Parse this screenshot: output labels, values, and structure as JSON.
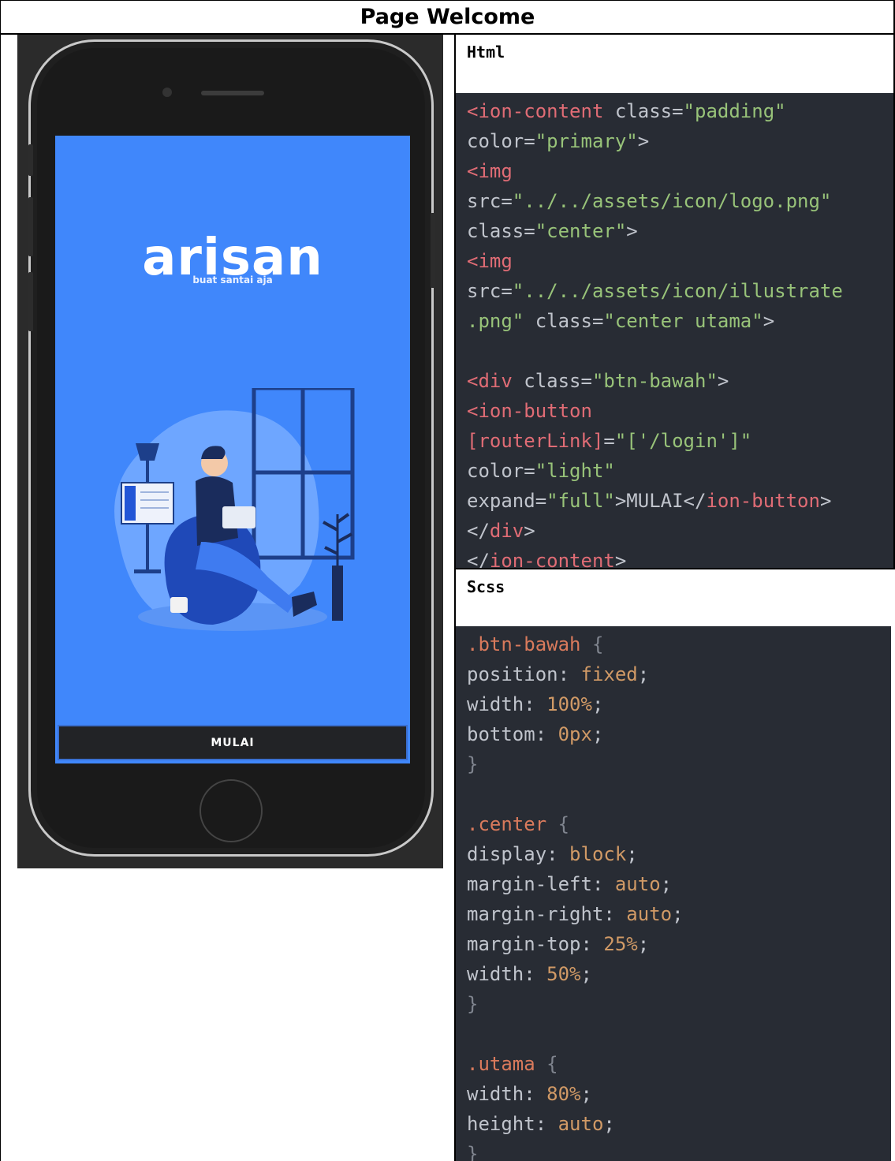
{
  "page_title": "Page Welcome",
  "phone": {
    "app_logo": "arisan",
    "tagline": "buat santai aja",
    "button_label": "MULAI",
    "screen_color": "#4087fb"
  },
  "html_section": {
    "label": "Html",
    "lines": [
      [
        {
          "c": "t",
          "v": "<ion-content "
        },
        {
          "c": "p",
          "v": "class="
        },
        {
          "c": "s",
          "v": "\"padding\""
        }
      ],
      [
        {
          "c": "p",
          "v": "color="
        },
        {
          "c": "s",
          "v": "\"primary\""
        },
        {
          "c": "p",
          "v": ">"
        }
      ],
      [
        {
          "c": "t",
          "v": "<img"
        }
      ],
      [
        {
          "c": "p",
          "v": "src="
        },
        {
          "c": "s",
          "v": "\"../../assets/icon/logo.png\""
        }
      ],
      [
        {
          "c": "p",
          "v": "class="
        },
        {
          "c": "s",
          "v": "\"center\""
        },
        {
          "c": "p",
          "v": ">"
        }
      ],
      [
        {
          "c": "t",
          "v": "<img"
        }
      ],
      [
        {
          "c": "p",
          "v": "src="
        },
        {
          "c": "s",
          "v": "\"../../assets/icon/illustrate"
        }
      ],
      [
        {
          "c": "s",
          "v": ".png\""
        },
        {
          "c": "p",
          "v": " class="
        },
        {
          "c": "s",
          "v": "\"center utama\""
        },
        {
          "c": "p",
          "v": ">"
        }
      ],
      [],
      [
        {
          "c": "t",
          "v": "<div "
        },
        {
          "c": "p",
          "v": "class="
        },
        {
          "c": "s",
          "v": "\"btn-bawah\""
        },
        {
          "c": "p",
          "v": ">"
        }
      ],
      [
        {
          "c": "t",
          "v": "<ion-button"
        }
      ],
      [
        {
          "c": "t",
          "v": "[routerLink]"
        },
        {
          "c": "p",
          "v": "="
        },
        {
          "c": "s",
          "v": "\"['/login']\""
        }
      ],
      [
        {
          "c": "p",
          "v": "color="
        },
        {
          "c": "s",
          "v": "\"light\""
        }
      ],
      [
        {
          "c": "p",
          "v": "expand="
        },
        {
          "c": "s",
          "v": "\"full\""
        },
        {
          "c": "p",
          "v": ">MULAI</"
        },
        {
          "c": "t",
          "v": "ion-button"
        },
        {
          "c": "p",
          "v": ">"
        }
      ],
      [
        {
          "c": "p",
          "v": "</"
        },
        {
          "c": "t",
          "v": "div"
        },
        {
          "c": "p",
          "v": ">"
        }
      ],
      [
        {
          "c": "p",
          "v": "</"
        },
        {
          "c": "t",
          "v": "ion-content"
        },
        {
          "c": "p",
          "v": ">"
        }
      ]
    ]
  },
  "scss_section": {
    "label": "Scss",
    "lines": [
      [
        {
          "c": "sel",
          "v": ".btn-bawah "
        },
        {
          "c": "brace",
          "v": "{"
        }
      ],
      [
        {
          "c": "p",
          "v": "position: "
        },
        {
          "c": "num",
          "v": "fixed"
        },
        {
          "c": "p",
          "v": ";"
        }
      ],
      [
        {
          "c": "p",
          "v": "width: "
        },
        {
          "c": "num",
          "v": "100%"
        },
        {
          "c": "p",
          "v": ";"
        }
      ],
      [
        {
          "c": "p",
          "v": "bottom: "
        },
        {
          "c": "num",
          "v": "0px"
        },
        {
          "c": "p",
          "v": ";"
        }
      ],
      [
        {
          "c": "brace",
          "v": "}"
        }
      ],
      [],
      [
        {
          "c": "sel",
          "v": ".center "
        },
        {
          "c": "brace",
          "v": "{"
        }
      ],
      [
        {
          "c": "p",
          "v": "display: "
        },
        {
          "c": "num",
          "v": "block"
        },
        {
          "c": "p",
          "v": ";"
        }
      ],
      [
        {
          "c": "p",
          "v": "margin-left: "
        },
        {
          "c": "num",
          "v": "auto"
        },
        {
          "c": "p",
          "v": ";"
        }
      ],
      [
        {
          "c": "p",
          "v": "margin-right: "
        },
        {
          "c": "num",
          "v": "auto"
        },
        {
          "c": "p",
          "v": ";"
        }
      ],
      [
        {
          "c": "p",
          "v": "margin-top: "
        },
        {
          "c": "num",
          "v": "25%"
        },
        {
          "c": "p",
          "v": ";"
        }
      ],
      [
        {
          "c": "p",
          "v": "width: "
        },
        {
          "c": "num",
          "v": "50%"
        },
        {
          "c": "p",
          "v": ";"
        }
      ],
      [
        {
          "c": "brace",
          "v": "}"
        }
      ],
      [],
      [
        {
          "c": "sel",
          "v": ".utama "
        },
        {
          "c": "brace",
          "v": "{"
        }
      ],
      [
        {
          "c": "p",
          "v": "width: "
        },
        {
          "c": "num",
          "v": "80%"
        },
        {
          "c": "p",
          "v": ";"
        }
      ],
      [
        {
          "c": "p",
          "v": "height: "
        },
        {
          "c": "num",
          "v": "auto"
        },
        {
          "c": "p",
          "v": ";"
        }
      ],
      [
        {
          "c": "brace",
          "v": "}"
        }
      ]
    ]
  }
}
